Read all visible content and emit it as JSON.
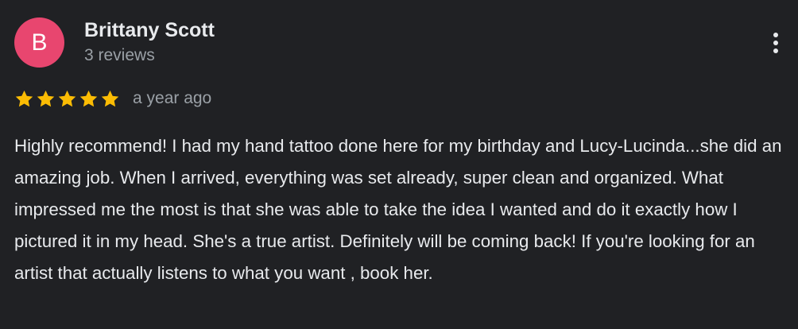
{
  "review": {
    "avatar_letter": "B",
    "avatar_color": "#e8466f",
    "author_name": "Brittany Scott",
    "review_count": "3 reviews",
    "rating": 5,
    "rating_max": 5,
    "star_color": "#fbbc04",
    "date": "a year ago",
    "text": "Highly recommend! I had my hand tattoo done here for my birthday and Lucy-Lucinda...she did an amazing job. When I arrived, everything was set already, super clean and organized. What impressed me the most is that she was able to take the idea I wanted and do it exactly how I pictured it in my head. She's a true artist. Definitely will be coming back! If you're looking for an artist that actually listens to what you want , book her."
  },
  "icons": {
    "more_options": "more-vert-icon",
    "star": "star-icon"
  }
}
